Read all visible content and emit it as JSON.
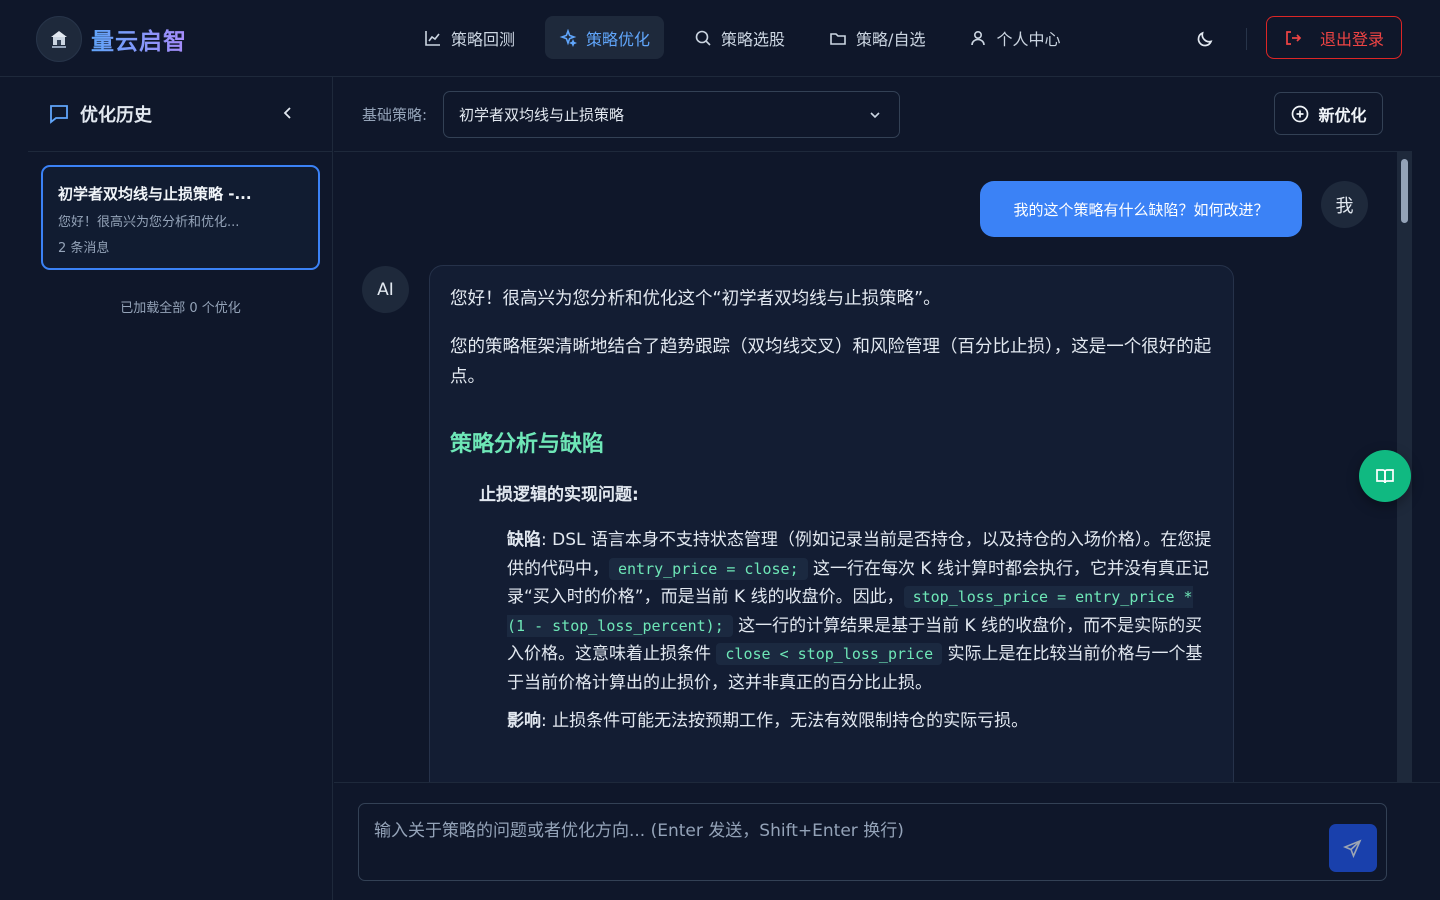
{
  "app": {
    "brand": "量云启智"
  },
  "nav": {
    "items": [
      {
        "label": "策略回测",
        "icon": "chart-line-icon"
      },
      {
        "label": "策略优化",
        "icon": "sparkles-icon",
        "active": true
      },
      {
        "label": "策略选股",
        "icon": "search-icon"
      },
      {
        "label": "策略/自选",
        "icon": "folder-icon"
      },
      {
        "label": "个人中心",
        "icon": "user-icon"
      }
    ],
    "theme_icon": "moon-icon",
    "logout_label": "退出登录"
  },
  "sidebar": {
    "title": "优化历史",
    "history": [
      {
        "title": "初学者双均线与止损策略 -...",
        "preview": "您好！很高兴为您分析和优化...",
        "count": "2 条消息"
      }
    ],
    "loaded_note": "已加载全部 0 个优化"
  },
  "toolbar": {
    "base_label": "基础策略:",
    "base_value": "初学者双均线与止损策略",
    "new_label": "新优化"
  },
  "chat": {
    "user_message": "我的这个策略有什么缺陷？如何改进？",
    "user_avatar": "我",
    "ai_avatar": "AI",
    "ai": {
      "p1": "您好！很高兴为您分析和优化这个“初学者双均线与止损策略”。",
      "p2": "您的策略框架清晰地结合了趋势跟踪（双均线交叉）和风险管理（百分比止损），这是一个很好的起点。",
      "heading": "策略分析与缺陷",
      "sub_heading": "止损逻辑的实现问题:",
      "defect_label": "缺陷",
      "defect_t1": ": DSL 语言本身不支持状态管理（例如记录当前是否持仓，以及持仓的入场价格）。在您提供的代码中，",
      "code1": "entry_price = close;",
      "defect_t2": " 这一行在每次 K 线计算时都会执行，它并没有真正记录“买入时的价格”，而是当前 K 线的收盘价。因此，",
      "code2": "stop_loss_price = entry_price * (1 - stop_loss_percent);",
      "defect_t3": " 这一行的计算结果是基于当前 K 线的收盘价，而不是实际的买入价格。这意味着止损条件 ",
      "code3": "close < stop_loss_price",
      "defect_t4": " 实际上是在比较当前价格与一个基于当前价格计算出的止损价，这并非真正的百分比止损。",
      "impact_label": "影响",
      "impact_text": ": 止损条件可能无法按预期工作，无法有效限制持仓的实际亏损。"
    }
  },
  "input": {
    "placeholder": "输入关于策略的问题或者优化方向... (Enter 发送，Shift+Enter 换行)"
  }
}
